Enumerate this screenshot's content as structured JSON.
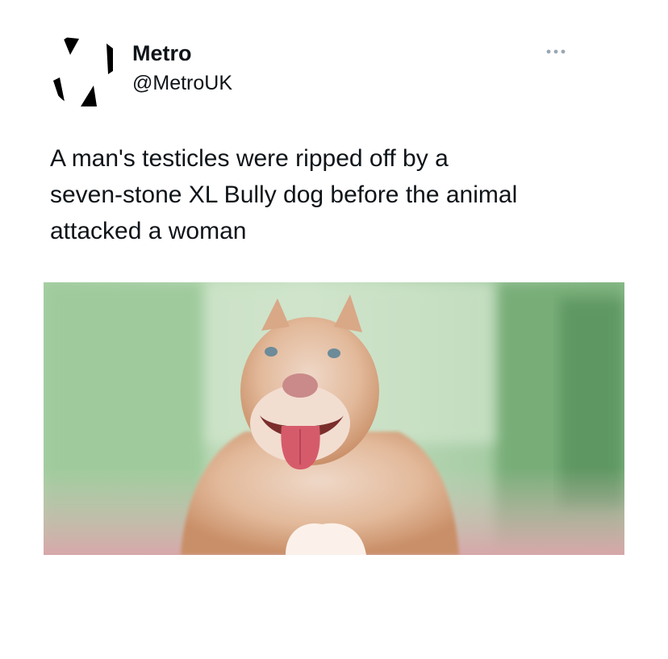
{
  "tweet": {
    "author": {
      "display_name": "Metro",
      "handle": "@MetroUK",
      "avatar_icon": "metro-logo-icon"
    },
    "menu_icon": "more-options-icon",
    "text": "A man's testicles were ripped off by a\nseven-stone XL Bully dog before the animal\nattacked a woman",
    "media": {
      "kind": "photo",
      "subject": "xl-bully-dog"
    }
  },
  "colors": {
    "text": "#0f1419",
    "secondary": "#536471",
    "background": "#ffffff"
  }
}
